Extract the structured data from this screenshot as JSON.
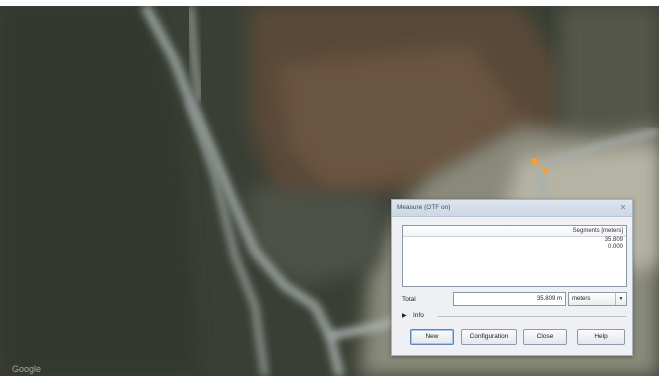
{
  "map": {
    "attribution": "Google"
  },
  "dialog": {
    "title": "Measure (OTF on)",
    "close_glyph": "✕",
    "list": {
      "header": "Segments [meters]",
      "rows": [
        "35.809",
        "0.000"
      ]
    },
    "total": {
      "label": "Total",
      "value": "35.809 m"
    },
    "unit_select": {
      "value": "meters",
      "arrow": "▼"
    },
    "info": {
      "arrow": "▶",
      "label": "Info"
    },
    "buttons": {
      "new": "New",
      "configuration": "Configuration",
      "close": "Close",
      "help": "Help"
    }
  }
}
